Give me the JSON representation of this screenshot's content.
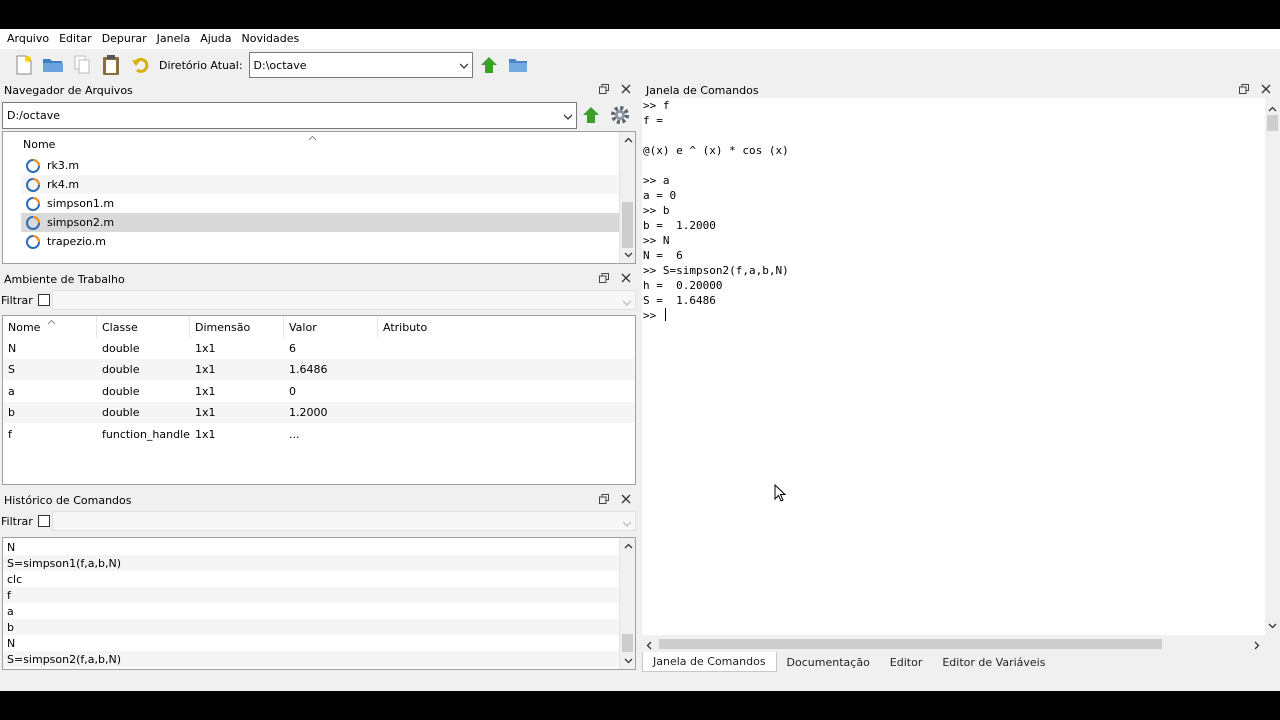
{
  "menu": [
    "Arquivo",
    "Editar",
    "Depurar",
    "Janela",
    "Ajuda",
    "Novidades"
  ],
  "toolbar": {
    "dir_label": "Diretório Atual:",
    "dir_value": "D:\\octave",
    "icons": [
      "new-file-icon",
      "open-folder-icon",
      "copy-icon",
      "paste-icon",
      "undo-icon",
      "go-up-icon",
      "browse-folder-icon"
    ]
  },
  "file_browser": {
    "title": "Navegador de Arquivos",
    "path": "D:/octave",
    "column": "Nome",
    "files": [
      "rk3.m",
      "rk4.m",
      "simpson1.m",
      "simpson2.m",
      "trapezio.m"
    ],
    "selected": "simpson2.m"
  },
  "workspace": {
    "title": "Ambiente de Trabalho",
    "filter_label": "Filtrar",
    "columns": [
      "Nome",
      "Classe",
      "Dimensão",
      "Valor",
      "Atributo"
    ],
    "rows": [
      [
        "N",
        "double",
        "1x1",
        "6",
        ""
      ],
      [
        "S",
        "double",
        "1x1",
        "1.6486",
        ""
      ],
      [
        "a",
        "double",
        "1x1",
        "0",
        ""
      ],
      [
        "b",
        "double",
        "1x1",
        "1.2000",
        ""
      ],
      [
        "f",
        "function_handle",
        "1x1",
        "...",
        ""
      ]
    ]
  },
  "history": {
    "title": "Histórico de Comandos",
    "filter_label": "Filtrar",
    "items": [
      "N",
      "S=simpson1(f,a,b,N)",
      "clc",
      "f",
      "a",
      "b",
      "N",
      "S=simpson2(f,a,b,N)"
    ]
  },
  "command_window": {
    "title": "Janela de Comandos",
    "lines": [
      ">> f",
      "f =",
      "",
      "@(x) e ^ (x) * cos (x)",
      "",
      ">> a",
      "a = 0",
      ">> b",
      "b =  1.2000",
      ">> N",
      "N =  6",
      ">> S=simpson2(f,a,b,N)",
      "h =  0.20000",
      "S =  1.6486"
    ],
    "prompt": ">> "
  },
  "bottom_tabs": [
    "Janela de Comandos",
    "Documentação",
    "Editor",
    "Editor de Variáveis"
  ]
}
